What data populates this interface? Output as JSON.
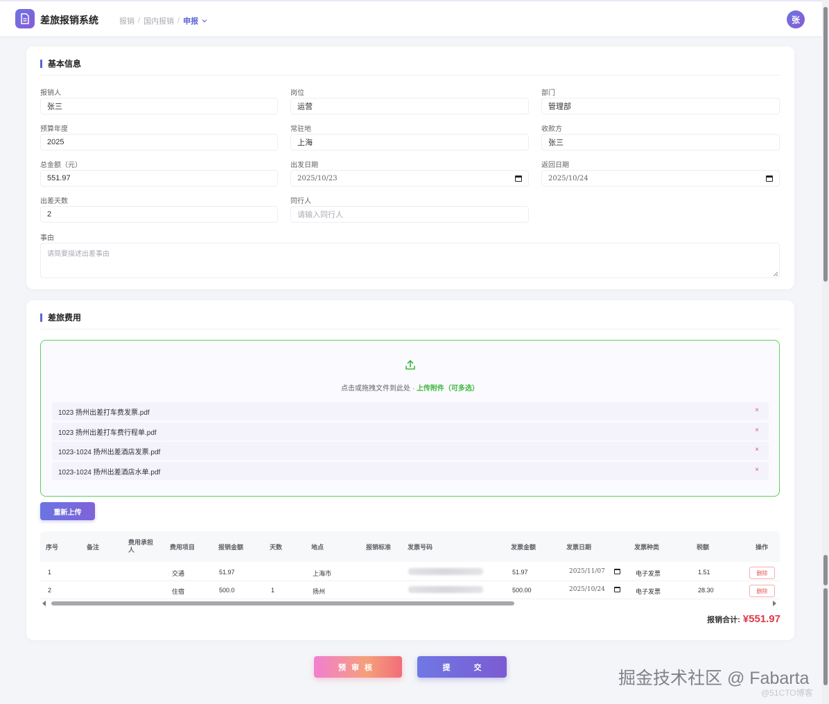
{
  "header": {
    "app_title": "差旅报销系统",
    "breadcrumb": [
      "报销",
      "国内报销"
    ],
    "breadcrumb_current": "申报",
    "avatar_text": "张",
    "accent_color": "#5b64d6"
  },
  "basic_info": {
    "title": "基本信息",
    "fields": {
      "claimant": {
        "label": "报销人",
        "value": "张三"
      },
      "position": {
        "label": "岗位",
        "value": "运营"
      },
      "department": {
        "label": "部门",
        "value": "管理部"
      },
      "budget_year": {
        "label": "预算年度",
        "value": "2025"
      },
      "base_location": {
        "label": "常驻地",
        "value": "上海"
      },
      "payee": {
        "label": "收款方",
        "value": "张三"
      },
      "total_amount": {
        "label": "总金额（元）",
        "value": "551.97"
      },
      "departure_date": {
        "label": "出发日期",
        "value": "2025/10/23"
      },
      "return_date": {
        "label": "返回日期",
        "value": "2025/10/24"
      },
      "trip_days": {
        "label": "出差天数",
        "value": "2"
      },
      "companions": {
        "label": "同行人",
        "placeholder": "请输入同行人"
      },
      "reason": {
        "label": "事由",
        "placeholder": "请简要描述出差事由"
      }
    }
  },
  "travel_expense": {
    "title": "差旅费用",
    "upload": {
      "hint": "点击或拖拽文件到此处 · ",
      "link": "上传附件（可多选）",
      "border_color": "#5dd05d"
    },
    "files": [
      {
        "name": "1023 扬州出差打车费发票.pdf",
        "remove": "×"
      },
      {
        "name": "1023 扬州出差打车费行程单.pdf",
        "remove": "×"
      },
      {
        "name": "1023-1024 扬州出差酒店发票.pdf",
        "remove": "×"
      },
      {
        "name": "1023-1024 扬州出差酒店水单.pdf",
        "remove": "×"
      }
    ],
    "reupload_label": "重新上传",
    "table": {
      "headers": [
        "序号",
        "备注",
        "费用承担人",
        "费用项目",
        "报销金额",
        "天数",
        "地点",
        "报销标准",
        "发票号码",
        "发票金额",
        "发票日期",
        "发票种类",
        "税额",
        "操作"
      ],
      "rows": [
        {
          "index": "1",
          "note": "",
          "bearer": "",
          "item": "交通",
          "amount": "51.97",
          "days": "",
          "location": "上海市",
          "standard": "",
          "invoice_amount": "51.97",
          "invoice_date": "2025/11/07",
          "invoice_type": "电子发票",
          "tax": "1.51",
          "action": "删除"
        },
        {
          "index": "2",
          "note": "",
          "bearer": "",
          "item": "住宿",
          "amount": "500.0",
          "days": "1",
          "location": "扬州",
          "standard": "",
          "invoice_amount": "500.00",
          "invoice_date": "2025/10/24",
          "invoice_type": "电子发票",
          "tax": "28.30",
          "action": "删除"
        }
      ]
    },
    "total_label": "报销合计:",
    "total_value": "¥551.97"
  },
  "actions": {
    "preaudit_label": "预审核",
    "submit_label": "提交"
  },
  "watermark": {
    "main": "掘金技术社区 @ Fabarta",
    "sub": "@51CTO博客"
  }
}
